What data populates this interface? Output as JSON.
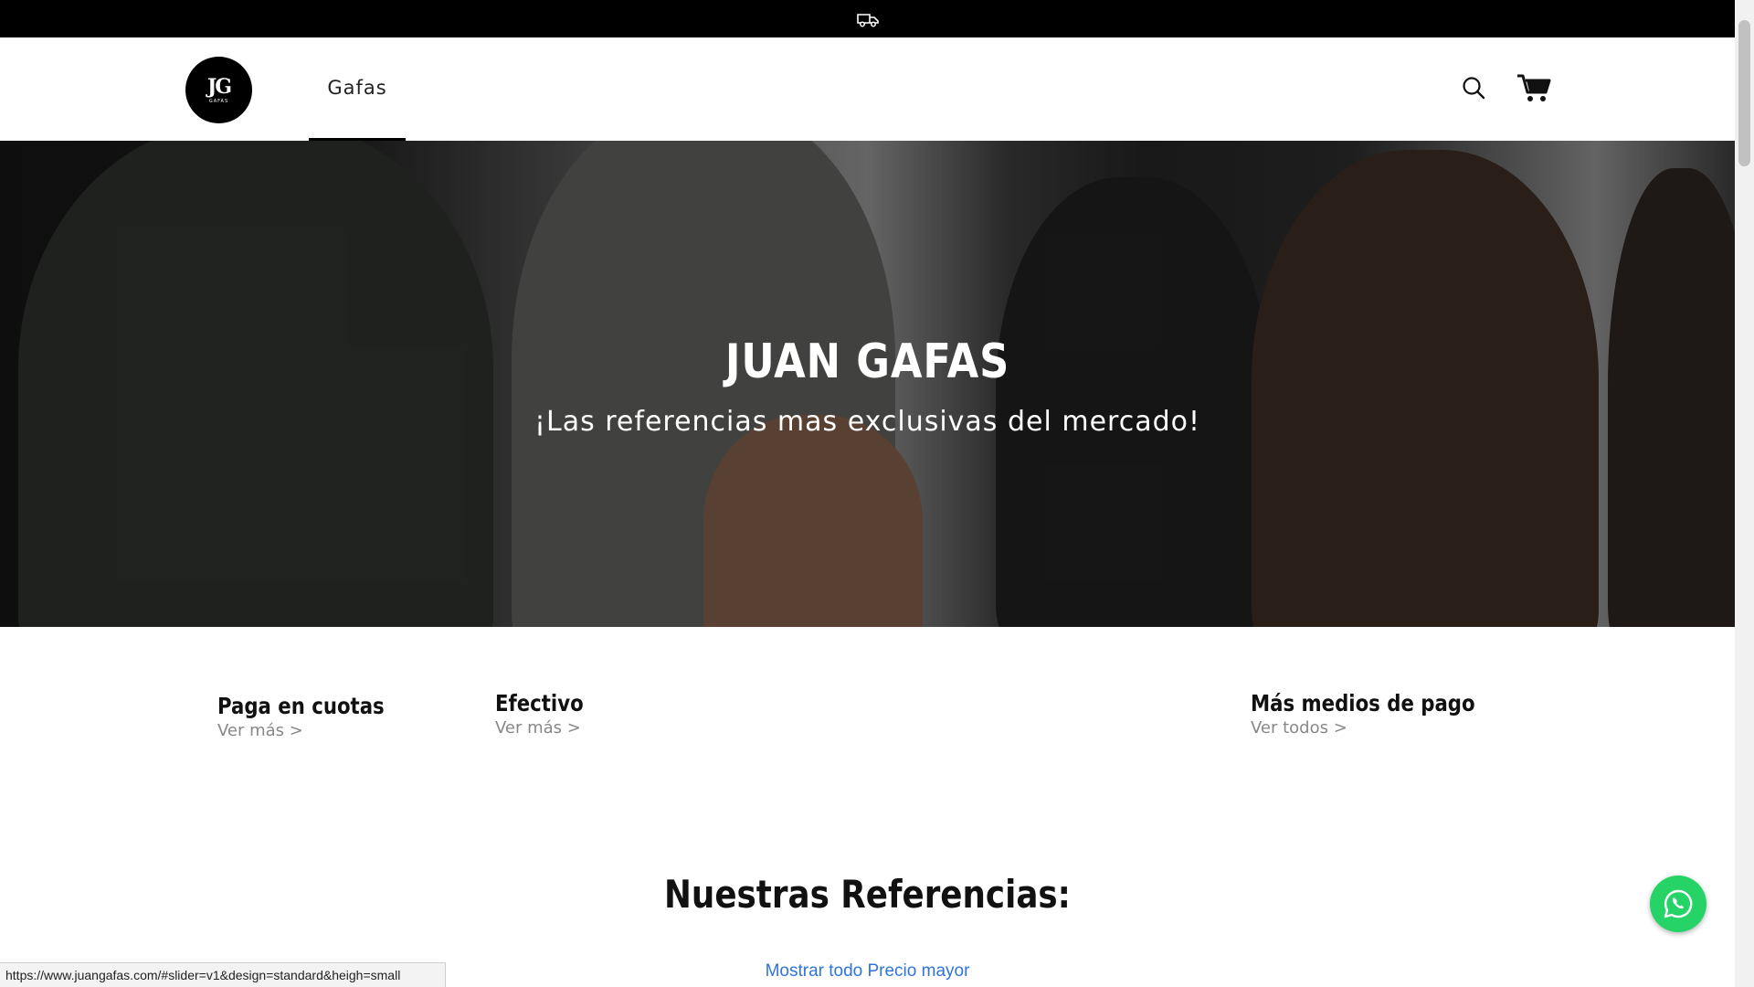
{
  "announcement": {
    "icon": "delivery-truck-icon"
  },
  "header": {
    "logo_mark": "JG",
    "logo_sub": "GAFAS",
    "nav": [
      {
        "label": "Gafas"
      }
    ],
    "icons": {
      "search": "search-icon",
      "cart": "cart-icon"
    }
  },
  "hero": {
    "title": "JUAN GAFAS",
    "subtitle": "¡Las referencias mas exclusivas del mercado!"
  },
  "payments": [
    {
      "title": "Paga en cuotas",
      "link": "Ver más >"
    },
    {
      "title": "Efectivo",
      "link": "Ver más >"
    },
    {
      "title": "Más medios de pago",
      "link": "Ver todos >"
    }
  ],
  "products": {
    "section_title": "Nuestras Referencias:",
    "sort_link": "Mostrar todo Precio mayor"
  },
  "status_bar": {
    "url": "https://www.juangafas.com/#slider=v1&design=standard&heigh=small"
  },
  "colors": {
    "accent_link": "#2f74d9",
    "whatsapp": "#25d366",
    "bar": "#000000"
  }
}
